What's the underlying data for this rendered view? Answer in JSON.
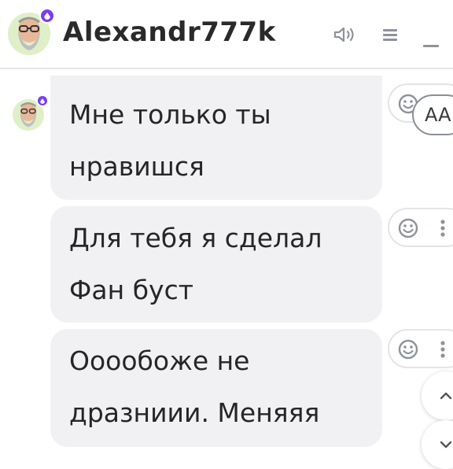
{
  "header": {
    "username": "Alexandr777k",
    "icons": [
      "sound-icon",
      "menu-icon",
      "minimize-icon"
    ]
  },
  "colors": {
    "status_dot": "#7a3cf0",
    "bubble_bg": "#f1f1f4",
    "avatar_bg": "#dff0c8"
  },
  "messages": [
    {
      "text": "Мне только ты\nнравишся"
    },
    {
      "text": "Для тебя я сделал\nФан буст"
    },
    {
      "text": "Ооообоже не\nдразниии. Меняяя"
    }
  ],
  "controls": {
    "font_size_label": "AA",
    "message_actions": [
      "emoji-icon",
      "more-icon"
    ],
    "scroll": [
      "chevron-up-icon",
      "chevron-down-icon"
    ]
  }
}
